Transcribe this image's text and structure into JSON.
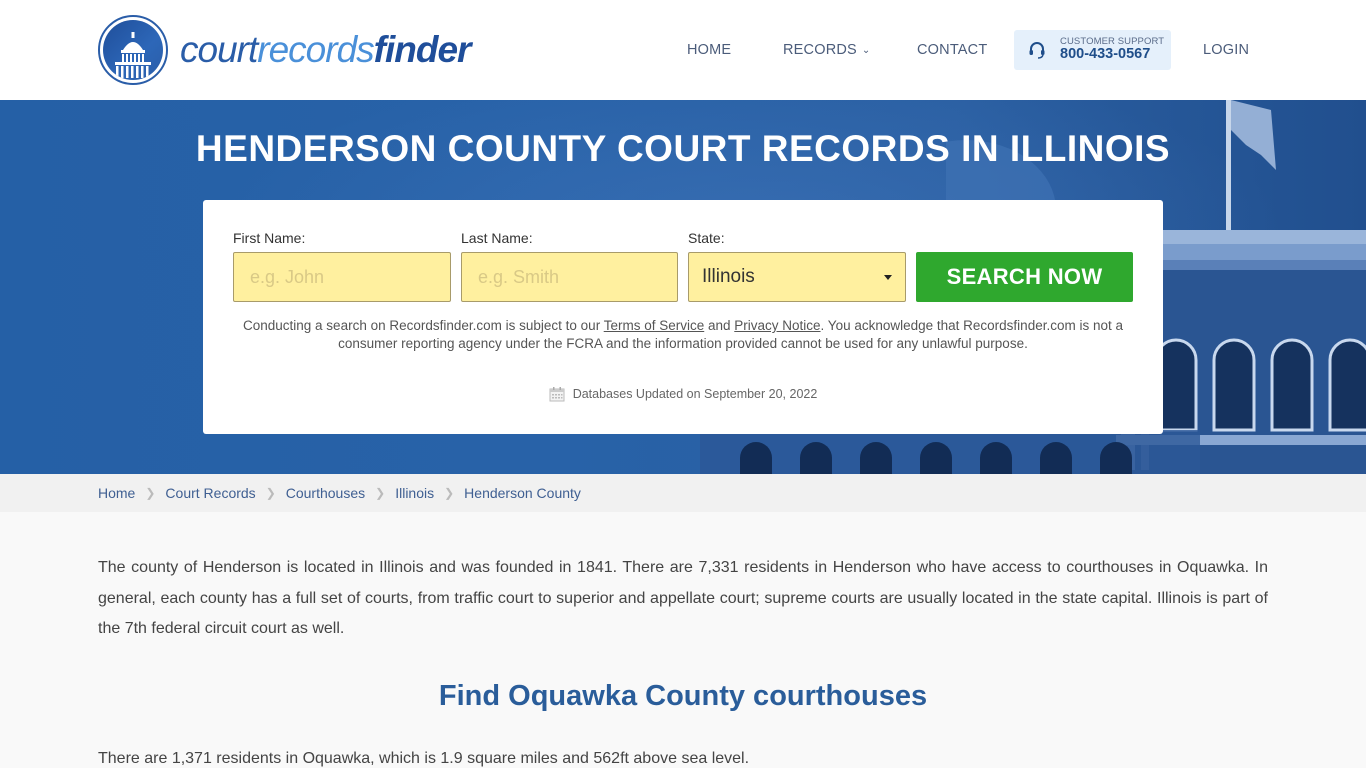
{
  "brand": {
    "logo_parts": [
      "court",
      "records",
      "finder"
    ]
  },
  "nav": {
    "home": "HOME",
    "records": "RECORDS",
    "contact": "CONTACT",
    "support_label": "CUSTOMER SUPPORT",
    "support_phone": "800-433-0567",
    "login": "LOGIN"
  },
  "hero": {
    "title": "HENDERSON COUNTY COURT RECORDS IN ILLINOIS"
  },
  "search": {
    "first_name_label": "First Name:",
    "first_name_placeholder": "e.g. John",
    "first_name_value": "",
    "last_name_label": "Last Name:",
    "last_name_placeholder": "e.g. Smith",
    "last_name_value": "",
    "state_label": "State:",
    "state_selected": "Illinois",
    "button_label": "SEARCH NOW",
    "disclaimer_pre": "Conducting a search on Recordsfinder.com is subject to our ",
    "terms_link": "Terms of Service",
    "disclaimer_and": " and ",
    "privacy_link": "Privacy Notice",
    "disclaimer_post": ". You acknowledge that Recordsfinder.com is not a consumer reporting agency under the FCRA and the information provided cannot be used for any unlawful purpose.",
    "db_updated": "Databases Updated on September 20, 2022"
  },
  "breadcrumb": [
    {
      "label": "Home"
    },
    {
      "label": "Court Records"
    },
    {
      "label": "Courthouses"
    },
    {
      "label": "Illinois"
    },
    {
      "label": "Henderson County"
    }
  ],
  "content": {
    "intro": "The county of Henderson is located in Illinois and was founded in 1841. There are 7,331 residents in Henderson who have access to courthouses in Oquawka. In general, each county has a full set of courts, from traffic court to superior and appellate court; supreme courts are usually located in the state capital. Illinois is part of the 7th federal circuit court as well.",
    "section_title": "Find Oquawka County courthouses",
    "section_text": "There are 1,371 residents in Oquawka, which is 1.9 square miles and 562ft above sea level."
  },
  "colors": {
    "brand_blue": "#2a5da8",
    "hero_blue": "#2760a6",
    "search_green": "#2fa82e",
    "input_yellow": "#fff09f",
    "heading_blue": "#2a5d9a"
  }
}
